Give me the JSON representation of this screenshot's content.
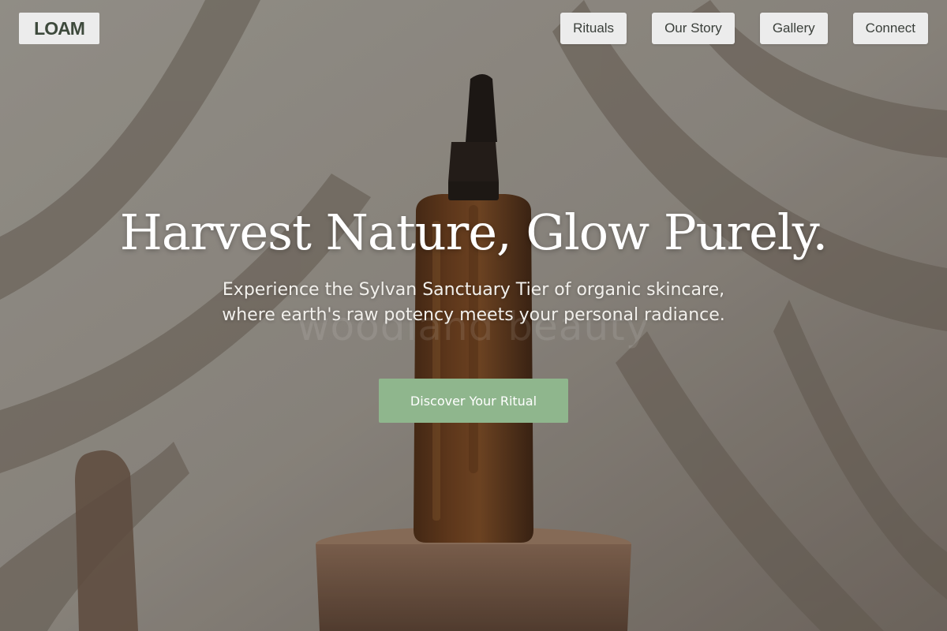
{
  "header": {
    "logo_text": "LOAM",
    "nav": [
      {
        "label": "Rituals"
      },
      {
        "label": "Our Story"
      },
      {
        "label": "Gallery"
      },
      {
        "label": "Connect"
      }
    ]
  },
  "hero": {
    "headline": "Harvest Nature, Glow Purely.",
    "subtext": "Experience the Sylvan Sanctuary Tier of organic skincare, where earth's raw potency meets your personal radiance.",
    "watermark": "woodland beauty",
    "cta_label": "Discover Your Ritual"
  },
  "colors": {
    "accent": "#8fb68d",
    "logo_text": "#3e4a3c",
    "nav_bg": "#ececec"
  }
}
